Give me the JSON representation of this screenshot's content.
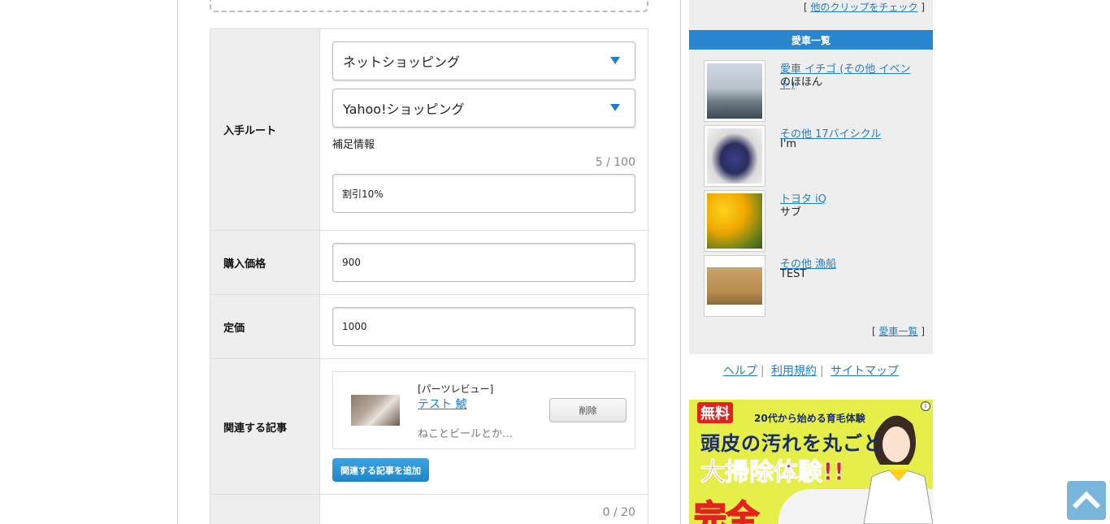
{
  "form": {
    "acquire_route": {
      "label": "入手ルート",
      "select1": "ネットショッピング",
      "select2": "Yahoo!ショッピング",
      "note_label": "補足情報",
      "note_counter": "5 / 100",
      "note_value": "割引10%"
    },
    "purchase_price": {
      "label": "購入価格",
      "value": "900"
    },
    "list_price": {
      "label": "定価",
      "value": "1000"
    },
    "related_articles": {
      "label": "関連する記事",
      "article": {
        "type": "[パーツレビュー]",
        "title": "テスト 鯱",
        "desc": "ねことビールとか…",
        "delete_label": "削除"
      },
      "add_label": "関連する記事を追加"
    },
    "next_counter": "0 / 20"
  },
  "sidebar": {
    "other_clips": "他のクリップをチェック",
    "car_header": "愛車一覧",
    "cars": [
      {
        "name": "愛車 イチゴ (その他 イベント)",
        "owner": "のほほん"
      },
      {
        "name": "その他 17バイシクル",
        "owner": "I'm"
      },
      {
        "name": "トヨタ iQ",
        "owner": "サブ"
      },
      {
        "name": "その他 漁船",
        "owner": "TEST"
      }
    ],
    "car_list_link": "愛車一覧"
  },
  "footer": {
    "help": "ヘルプ",
    "terms": "利用規約",
    "sitemap": "サイトマップ"
  },
  "ad": {
    "free": "無料",
    "sub": "20代から始める育毛体験",
    "head1": "頭皮の汚れを丸ごと",
    "head2": "大掃除体験!!",
    "big": "完全",
    "info": "i"
  },
  "colors": {
    "accent": "#1e7fc6",
    "header_blue": "#2a85cf",
    "totop": "#79b6de"
  },
  "icons": {
    "select_arrow": "triangle-down-icon",
    "totop": "chevron-up-icon",
    "ad_info": "info-icon"
  }
}
